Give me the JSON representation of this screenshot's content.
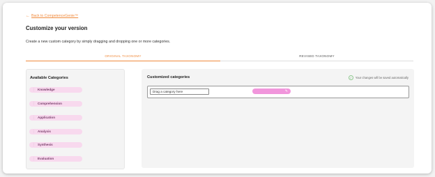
{
  "nav": {
    "back_label": "Back to CompetenceGenie™"
  },
  "page": {
    "title": "Customize your version",
    "subtitle": "Create a new custom category by simply dragging and dropping one or more categories."
  },
  "tabs": [
    {
      "label": "ORIGINAL TAXONOMY",
      "active": true
    },
    {
      "label": "REVISED TAXONOMY",
      "active": false
    }
  ],
  "available": {
    "heading": "Available Categories",
    "items": [
      {
        "label": "Knowledge"
      },
      {
        "label": "Comprehension"
      },
      {
        "label": "Application"
      },
      {
        "label": "Analysis"
      },
      {
        "label": "Synthesis"
      },
      {
        "label": "Evaluation"
      }
    ]
  },
  "customized": {
    "heading": "Customized categories",
    "autosave_note": "Your changes will be saved automatically",
    "drop_placeholder": "Drag a category here"
  },
  "colors": {
    "accent": "#f08a3c",
    "pill": "#f8d9ee",
    "pill_text": "#7a3f6c",
    "drop_pill": "#f196dc",
    "success": "#6fb26f"
  },
  "icons": {
    "back": "arrow-left-icon",
    "grip": "drag-grip-icon",
    "check": "check-circle-icon",
    "edit": "edit-icon"
  }
}
